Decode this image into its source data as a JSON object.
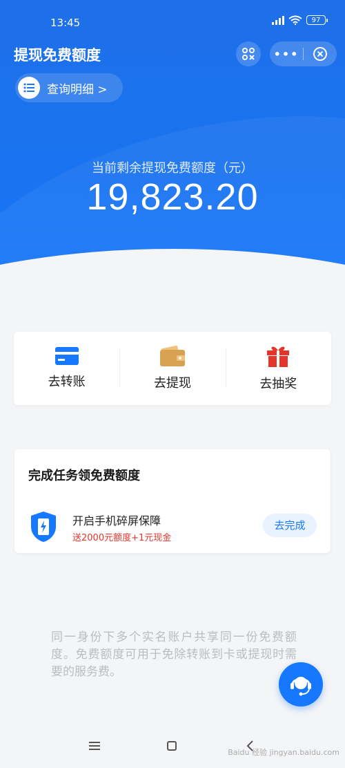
{
  "status_bar": {
    "time": "13:45",
    "battery": "97"
  },
  "header": {
    "title": "提现免费额度",
    "more_icon": "more-dots-icon",
    "close_icon": "close-circle-icon",
    "scan_icon": "qr-scan-icon"
  },
  "detail_button": {
    "label": "查询明细 >",
    "icon": "list-icon"
  },
  "quota": {
    "label": "当前剩余提现免费额度（元）",
    "value": "19,823.20"
  },
  "actions": [
    {
      "label": "去转账",
      "icon": "card-icon"
    },
    {
      "label": "去提现",
      "icon": "wallet-icon"
    },
    {
      "label": "去抽奖",
      "icon": "gift-icon"
    }
  ],
  "task_card": {
    "title": "完成任务领免费额度",
    "task": {
      "name": "开启手机碎屏保障",
      "desc": "送2000元额度+1元现金",
      "button": "去完成",
      "icon": "phone-shield-icon"
    }
  },
  "notice": "同一身份下多个实名账户共享同一份免费额度。免费额度可用于免除转账到卡或提现时需要的服务费。",
  "service_icon": "customer-service-icon",
  "nav": {
    "menu_icon": "menu-icon",
    "home_icon": "home-square-icon",
    "back_icon": "back-chevron-icon"
  },
  "watermark": "Baidu 经验 jingyan.baidu.com",
  "colors": {
    "primary": "#1677ff",
    "accent_red": "#e5352b",
    "wallet_gold": "#d9a253"
  }
}
